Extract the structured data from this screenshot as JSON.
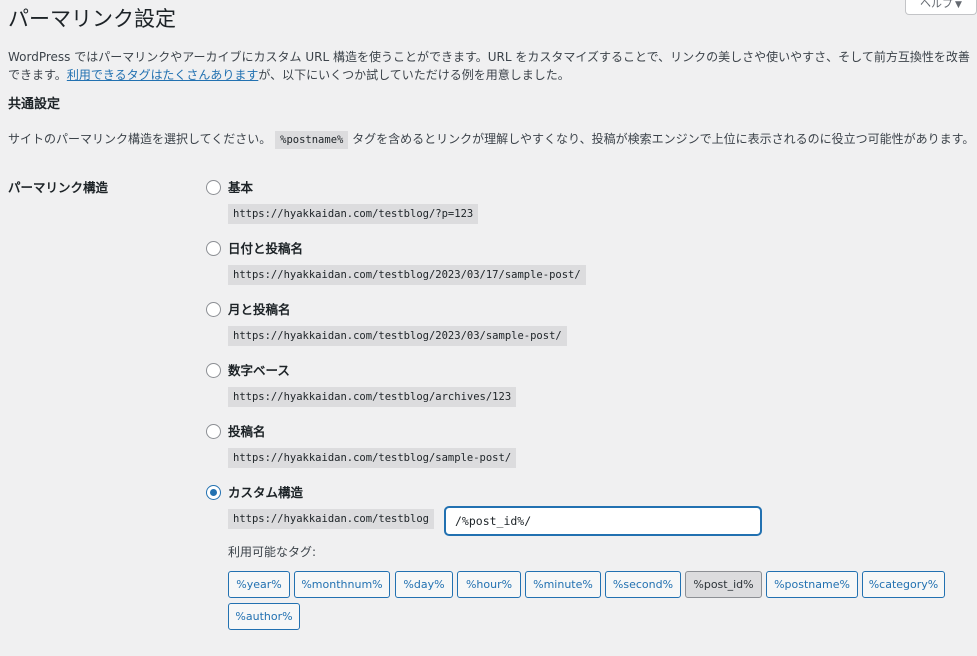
{
  "help_tab": {
    "label": "ヘルプ"
  },
  "page_title": "パーマリンク設定",
  "intro": {
    "text_1": "WordPress ではパーマリンクやアーカイブにカスタム URL 構造を使うことができます。URL をカスタマイズすることで、リンクの美しさや使いやすさ、そして前方互換性を改善できます。",
    "link": "利用できるタグはたくさんあります",
    "text_2": "が、以下にいくつか試していただける例を用意しました。"
  },
  "section_heading": "共通設定",
  "description": {
    "before": "サイトのパーマリンク構造を選択してください。",
    "code": "%postname%",
    "after": "タグを含めるとリンクが理解しやすくなり、投稿が検索エンジンで上位に表示されるのに役立つ可能性があります。"
  },
  "structure_label": "パーマリンク構造",
  "options": [
    {
      "label": "基本",
      "example": "https://hyakkaidan.com/testblog/?p=123",
      "checked": false
    },
    {
      "label": "日付と投稿名",
      "example": "https://hyakkaidan.com/testblog/2023/03/17/sample-post/",
      "checked": false
    },
    {
      "label": "月と投稿名",
      "example": "https://hyakkaidan.com/testblog/2023/03/sample-post/",
      "checked": false
    },
    {
      "label": "数字ベース",
      "example": "https://hyakkaidan.com/testblog/archives/123",
      "checked": false
    },
    {
      "label": "投稿名",
      "example": "https://hyakkaidan.com/testblog/sample-post/",
      "checked": false
    },
    {
      "label": "カスタム構造",
      "example": "https://hyakkaidan.com/testblog",
      "checked": true
    }
  ],
  "custom_structure": {
    "value": "/%post_id%/"
  },
  "available_tags_label": "利用可能なタグ:",
  "tags": [
    {
      "label": "%year%",
      "active": false
    },
    {
      "label": "%monthnum%",
      "active": false
    },
    {
      "label": "%day%",
      "active": false
    },
    {
      "label": "%hour%",
      "active": false
    },
    {
      "label": "%minute%",
      "active": false
    },
    {
      "label": "%second%",
      "active": false
    },
    {
      "label": "%post_id%",
      "active": true
    },
    {
      "label": "%postname%",
      "active": false
    },
    {
      "label": "%category%",
      "active": false
    },
    {
      "label": "%author%",
      "active": false
    }
  ],
  "colors": {
    "accent": "#2271b1",
    "background": "#f0f0f1",
    "code_bg": "#dcdcde"
  }
}
